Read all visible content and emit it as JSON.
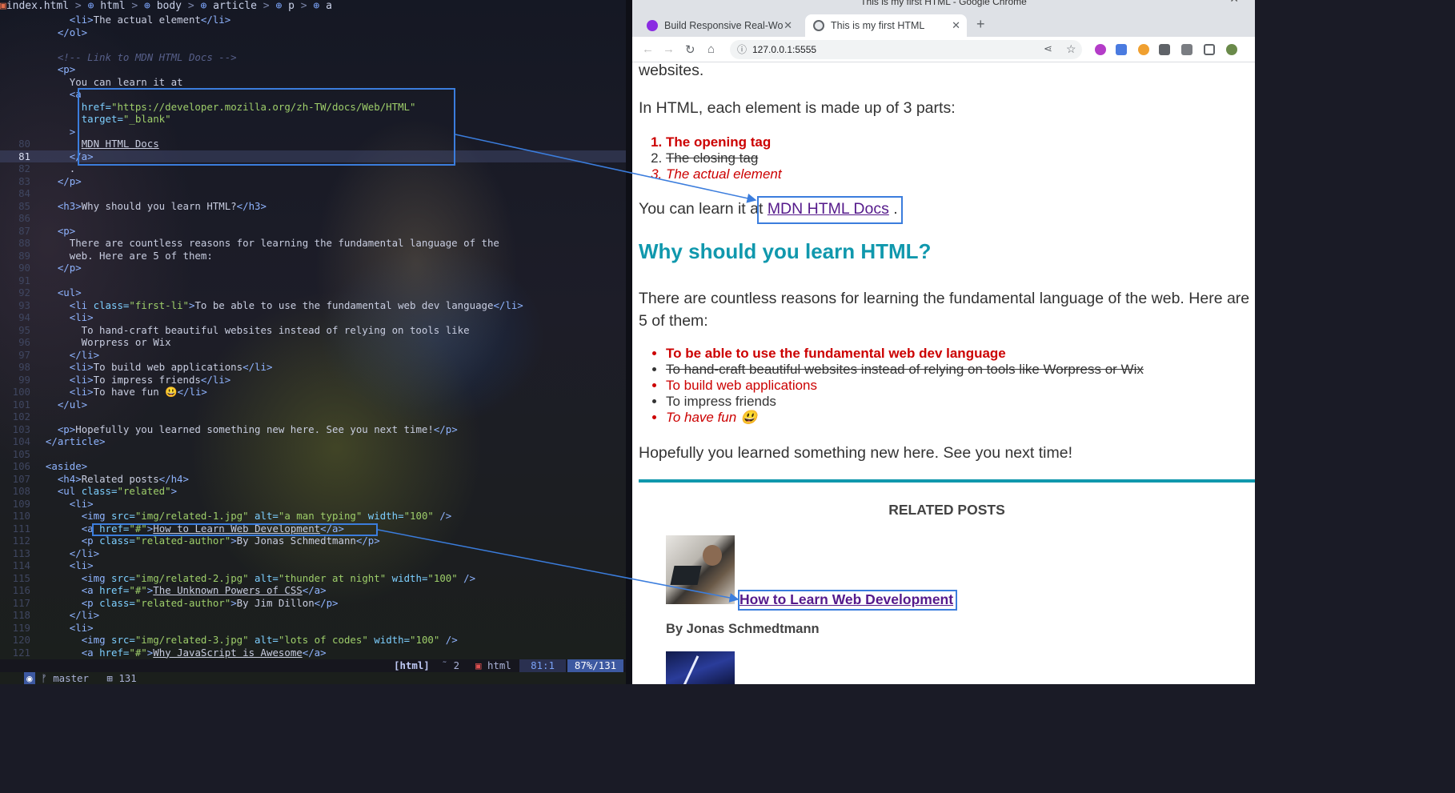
{
  "editor": {
    "breadcrumb": [
      "index.html",
      "html",
      "body",
      "article",
      "p",
      "a"
    ],
    "lines": [
      {
        "n": "",
        "segs": [
          [
            "      ",
            "tx"
          ],
          [
            "<li>",
            "tg"
          ],
          [
            "The actual element",
            "tx"
          ],
          [
            "</li>",
            "tg"
          ]
        ]
      },
      {
        "n": "",
        "segs": [
          [
            "    ",
            "tx"
          ],
          [
            "</ol>",
            "tg"
          ]
        ]
      },
      {
        "n": "",
        "segs": []
      },
      {
        "n": "",
        "segs": [
          [
            "    ",
            "tx"
          ],
          [
            "<!-- Link to MDN HTML Docs -->",
            "cm"
          ]
        ]
      },
      {
        "n": "",
        "segs": [
          [
            "    ",
            "tx"
          ],
          [
            "<p>",
            "tg"
          ]
        ]
      },
      {
        "n": "",
        "segs": [
          [
            "      You can learn it at",
            "tx"
          ]
        ]
      },
      {
        "n": "",
        "segs": [
          [
            "      ",
            "tx"
          ],
          [
            "<a",
            "tg"
          ]
        ]
      },
      {
        "n": "",
        "segs": [
          [
            "        ",
            "tx"
          ],
          [
            "href=",
            "at"
          ],
          [
            "\"https://developer.mozilla.org/zh-TW/docs/Web/HTML\"",
            "st"
          ]
        ]
      },
      {
        "n": "",
        "segs": [
          [
            "        ",
            "tx"
          ],
          [
            "target=",
            "at"
          ],
          [
            "\"_blank\"",
            "st"
          ]
        ]
      },
      {
        "n": "",
        "segs": [
          [
            "      ",
            "tx"
          ],
          [
            ">",
            "tg"
          ]
        ]
      },
      {
        "n": "80",
        "segs": [
          [
            "        ",
            "tx"
          ],
          [
            "MDN HTML Docs",
            "tx un"
          ]
        ]
      },
      {
        "n": "81",
        "cur": true,
        "segs": [
          [
            "      ",
            "tx"
          ],
          [
            "</a>",
            "tg"
          ]
        ]
      },
      {
        "n": "82",
        "segs": [
          [
            "      .",
            "tx"
          ]
        ]
      },
      {
        "n": "83",
        "segs": [
          [
            "    ",
            "tx"
          ],
          [
            "</p>",
            "tg"
          ]
        ]
      },
      {
        "n": "84",
        "segs": []
      },
      {
        "n": "85",
        "segs": [
          [
            "    ",
            "tx"
          ],
          [
            "<h3>",
            "tg"
          ],
          [
            "Why should you learn HTML?",
            "tx"
          ],
          [
            "</h3>",
            "tg"
          ]
        ]
      },
      {
        "n": "86",
        "segs": []
      },
      {
        "n": "87",
        "segs": [
          [
            "    ",
            "tx"
          ],
          [
            "<p>",
            "tg"
          ]
        ]
      },
      {
        "n": "88",
        "segs": [
          [
            "      There are countless reasons for learning the fundamental language of the",
            "tx"
          ]
        ]
      },
      {
        "n": "89",
        "segs": [
          [
            "      web. Here are 5 of them:",
            "tx"
          ]
        ]
      },
      {
        "n": "90",
        "segs": [
          [
            "    ",
            "tx"
          ],
          [
            "</p>",
            "tg"
          ]
        ]
      },
      {
        "n": "91",
        "segs": []
      },
      {
        "n": "92",
        "segs": [
          [
            "    ",
            "tx"
          ],
          [
            "<ul>",
            "tg"
          ]
        ]
      },
      {
        "n": "93",
        "segs": [
          [
            "      ",
            "tx"
          ],
          [
            "<li ",
            "tg"
          ],
          [
            "class=",
            "at"
          ],
          [
            "\"first-li\"",
            "st"
          ],
          [
            ">",
            "tg"
          ],
          [
            "To be able to use the fundamental web dev language",
            "tx"
          ],
          [
            "</li>",
            "tg"
          ]
        ]
      },
      {
        "n": "94",
        "segs": [
          [
            "      ",
            "tx"
          ],
          [
            "<li>",
            "tg"
          ]
        ]
      },
      {
        "n": "95",
        "segs": [
          [
            "        To hand-craft beautiful websites instead of relying on tools like",
            "tx"
          ]
        ]
      },
      {
        "n": "96",
        "segs": [
          [
            "        Worpress or Wix",
            "tx"
          ]
        ]
      },
      {
        "n": "97",
        "segs": [
          [
            "      ",
            "tx"
          ],
          [
            "</li>",
            "tg"
          ]
        ]
      },
      {
        "n": "98",
        "segs": [
          [
            "      ",
            "tx"
          ],
          [
            "<li>",
            "tg"
          ],
          [
            "To build web applications",
            "tx"
          ],
          [
            "</li>",
            "tg"
          ]
        ]
      },
      {
        "n": "99",
        "segs": [
          [
            "      ",
            "tx"
          ],
          [
            "<li>",
            "tg"
          ],
          [
            "To impress friends",
            "tx"
          ],
          [
            "</li>",
            "tg"
          ]
        ]
      },
      {
        "n": "100",
        "segs": [
          [
            "      ",
            "tx"
          ],
          [
            "<li>",
            "tg"
          ],
          [
            "To have fun 😃",
            "tx"
          ],
          [
            "</li>",
            "tg"
          ]
        ]
      },
      {
        "n": "101",
        "segs": [
          [
            "    ",
            "tx"
          ],
          [
            "</ul>",
            "tg"
          ]
        ]
      },
      {
        "n": "102",
        "segs": []
      },
      {
        "n": "103",
        "segs": [
          [
            "    ",
            "tx"
          ],
          [
            "<p>",
            "tg"
          ],
          [
            "Hopefully you learned something new here. See you next time!",
            "tx"
          ],
          [
            "</p>",
            "tg"
          ]
        ]
      },
      {
        "n": "104",
        "segs": [
          [
            "  ",
            "tx"
          ],
          [
            "</article>",
            "tg"
          ]
        ]
      },
      {
        "n": "105",
        "segs": []
      },
      {
        "n": "106",
        "segs": [
          [
            "  ",
            "tx"
          ],
          [
            "<aside>",
            "tg"
          ]
        ]
      },
      {
        "n": "107",
        "segs": [
          [
            "    ",
            "tx"
          ],
          [
            "<h4>",
            "tg"
          ],
          [
            "Related posts",
            "tx"
          ],
          [
            "</h4>",
            "tg"
          ]
        ]
      },
      {
        "n": "108",
        "segs": [
          [
            "    ",
            "tx"
          ],
          [
            "<ul ",
            "tg"
          ],
          [
            "class=",
            "at"
          ],
          [
            "\"related\"",
            "st"
          ],
          [
            ">",
            "tg"
          ]
        ]
      },
      {
        "n": "109",
        "segs": [
          [
            "      ",
            "tx"
          ],
          [
            "<li>",
            "tg"
          ]
        ]
      },
      {
        "n": "110",
        "segs": [
          [
            "        ",
            "tx"
          ],
          [
            "<img ",
            "tg"
          ],
          [
            "src=",
            "at"
          ],
          [
            "\"img/related-1.jpg\"",
            "st"
          ],
          [
            " alt=",
            "at"
          ],
          [
            "\"a man typing\"",
            "st"
          ],
          [
            " width=",
            "at"
          ],
          [
            "\"100\"",
            "st"
          ],
          [
            " />",
            "tg"
          ]
        ]
      },
      {
        "n": "111",
        "segs": [
          [
            "        ",
            "tx"
          ],
          [
            "<a ",
            "tg"
          ],
          [
            "href=",
            "at"
          ],
          [
            "\"#\"",
            "st"
          ],
          [
            ">",
            "tg"
          ],
          [
            "How to Learn Web Development",
            "tx un"
          ],
          [
            "</a>",
            "tg"
          ]
        ]
      },
      {
        "n": "112",
        "segs": [
          [
            "        ",
            "tx"
          ],
          [
            "<p ",
            "tg"
          ],
          [
            "class=",
            "at"
          ],
          [
            "\"related-author\"",
            "st"
          ],
          [
            ">",
            "tg"
          ],
          [
            "By Jonas Schmedtmann",
            "tx"
          ],
          [
            "</p>",
            "tg"
          ]
        ]
      },
      {
        "n": "113",
        "segs": [
          [
            "      ",
            "tx"
          ],
          [
            "</li>",
            "tg"
          ]
        ]
      },
      {
        "n": "114",
        "segs": [
          [
            "      ",
            "tx"
          ],
          [
            "<li>",
            "tg"
          ]
        ]
      },
      {
        "n": "115",
        "segs": [
          [
            "        ",
            "tx"
          ],
          [
            "<img ",
            "tg"
          ],
          [
            "src=",
            "at"
          ],
          [
            "\"img/related-2.jpg\"",
            "st"
          ],
          [
            " alt=",
            "at"
          ],
          [
            "\"thunder at night\"",
            "st"
          ],
          [
            " width=",
            "at"
          ],
          [
            "\"100\"",
            "st"
          ],
          [
            " />",
            "tg"
          ]
        ]
      },
      {
        "n": "116",
        "segs": [
          [
            "        ",
            "tx"
          ],
          [
            "<a ",
            "tg"
          ],
          [
            "href=",
            "at"
          ],
          [
            "\"#\"",
            "st"
          ],
          [
            ">",
            "tg"
          ],
          [
            "The Unknown Powers of CSS",
            "tx un"
          ],
          [
            "</a>",
            "tg"
          ]
        ]
      },
      {
        "n": "117",
        "segs": [
          [
            "        ",
            "tx"
          ],
          [
            "<p ",
            "tg"
          ],
          [
            "class=",
            "at"
          ],
          [
            "\"related-author\"",
            "st"
          ],
          [
            ">",
            "tg"
          ],
          [
            "By Jim Dillon",
            "tx"
          ],
          [
            "</p>",
            "tg"
          ]
        ]
      },
      {
        "n": "118",
        "segs": [
          [
            "      ",
            "tx"
          ],
          [
            "</li>",
            "tg"
          ]
        ]
      },
      {
        "n": "119",
        "segs": [
          [
            "      ",
            "tx"
          ],
          [
            "<li>",
            "tg"
          ]
        ]
      },
      {
        "n": "120",
        "segs": [
          [
            "        ",
            "tx"
          ],
          [
            "<img ",
            "tg"
          ],
          [
            "src=",
            "at"
          ],
          [
            "\"img/related-3.jpg\"",
            "st"
          ],
          [
            " alt=",
            "at"
          ],
          [
            "\"lots of codes\"",
            "st"
          ],
          [
            " width=",
            "at"
          ],
          [
            "\"100\"",
            "st"
          ],
          [
            " />",
            "tg"
          ]
        ]
      },
      {
        "n": "121",
        "segs": [
          [
            "        ",
            "tx"
          ],
          [
            "<a ",
            "tg"
          ],
          [
            "href=",
            "at"
          ],
          [
            "\"#\"",
            "st"
          ],
          [
            ">",
            "tg"
          ],
          [
            "Why JavaScript is Awesome",
            "tx un"
          ],
          [
            "</a>",
            "tg"
          ]
        ]
      }
    ],
    "status": {
      "branch": "master",
      "lines": "131",
      "filetype_bracket": "[html]",
      "count": "2",
      "filetype": "html",
      "position": "81:1",
      "percent": "87%/131"
    }
  },
  "browser": {
    "title": "This is my first HTML - Google Chrome",
    "tabs": [
      {
        "label": "Build Responsive Real-Wo"
      },
      {
        "label": "This is my first HTML"
      }
    ],
    "url": "127.0.0.1:5555",
    "page": {
      "top_fragment": "websites.",
      "parts_intro": "In HTML, each element is made up of 3 parts:",
      "parts": [
        "The opening tag",
        "The closing tag",
        "The actual element"
      ],
      "learn_prefix": "You can learn it at",
      "learn_link": "MDN HTML Docs",
      "learn_suffix": ".",
      "why_heading": "Why should you learn HTML?",
      "reasons_intro": "There are countless reasons for learning the fundamental language of the web. Here are 5 of them:",
      "reasons": [
        "To be able to use the fundamental web dev language",
        "To hand-craft beautiful websites instead of relying on tools like Worpress or Wix",
        "To build web applications",
        "To impress friends",
        "To have fun 😃"
      ],
      "closing": "Hopefully you learned something new here. See you next time!",
      "related_title": "RELATED POSTS",
      "related": [
        {
          "link": "How to Learn Web Development",
          "author": "By Jonas Schmedtmann"
        }
      ]
    }
  }
}
